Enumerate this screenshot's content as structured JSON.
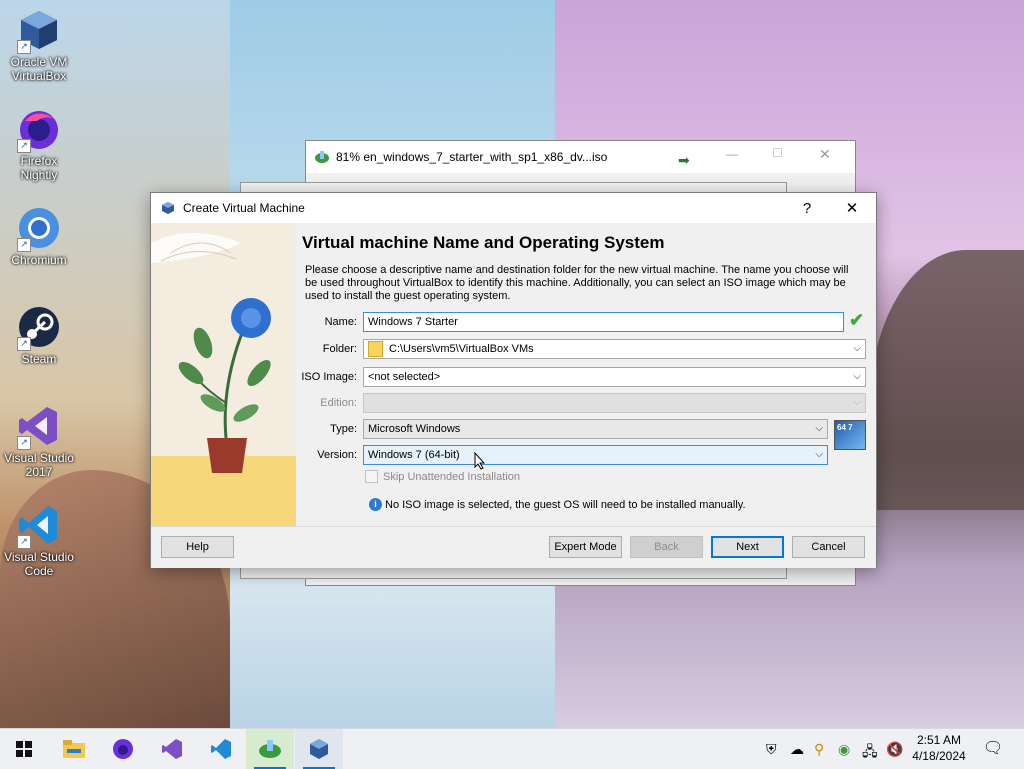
{
  "desktop_icons": [
    {
      "label": "Oracle VM VirtualBox",
      "icon": "virtualbox-icon"
    },
    {
      "label": "Firefox Nightly",
      "icon": "firefox-nightly-icon"
    },
    {
      "label": "Chromium",
      "icon": "chromium-icon"
    },
    {
      "label": "Steam",
      "icon": "steam-icon"
    },
    {
      "label": "Visual Studio 2017",
      "icon": "visual-studio-icon"
    },
    {
      "label": "Visual Studio Code",
      "icon": "vscode-icon"
    }
  ],
  "download_window": {
    "title": "81% en_windows_7_starter_with_sp1_x86_dv...iso"
  },
  "dialog": {
    "title": "Create Virtual Machine",
    "help_glyph": "?",
    "close_glyph": "✕",
    "heading": "Virtual machine Name and Operating System",
    "description": "Please choose a descriptive name and destination folder for the new virtual machine. The name you choose will be used throughout VirtualBox to identify this machine. Additionally, you can select an ISO image which may be used to install the guest operating system.",
    "fields": {
      "name_label": "Name:",
      "name_value": "Windows 7 Starter",
      "folder_label": "Folder:",
      "folder_value": "C:\\Users\\vm5\\VirtualBox VMs",
      "iso_label": "ISO Image:",
      "iso_value": "<not selected>",
      "edition_label": "Edition:",
      "edition_value": "",
      "type_label": "Type:",
      "type_value": "Microsoft Windows",
      "version_label": "Version:",
      "version_value": "Windows 7 (64-bit)",
      "os_badge": "64 7"
    },
    "skip_unattended_label": "Skip Unattended Installation",
    "info_message": "No ISO image is selected, the guest OS will need to be installed manually.",
    "buttons": {
      "help": "Help",
      "expert": "Expert Mode",
      "back": "Back",
      "next": "Next",
      "cancel": "Cancel"
    }
  },
  "taskbar": {
    "apps": [
      "windows-start-icon",
      "file-explorer-icon",
      "firefox-nightly-icon",
      "visual-studio-icon",
      "vscode-icon",
      "download-manager-icon",
      "virtualbox-icon"
    ],
    "clock_time": "2:51 AM",
    "clock_date": "4/18/2024"
  },
  "colors": {
    "accent": "#0078d7",
    "valid_check": "#3fa83f"
  }
}
